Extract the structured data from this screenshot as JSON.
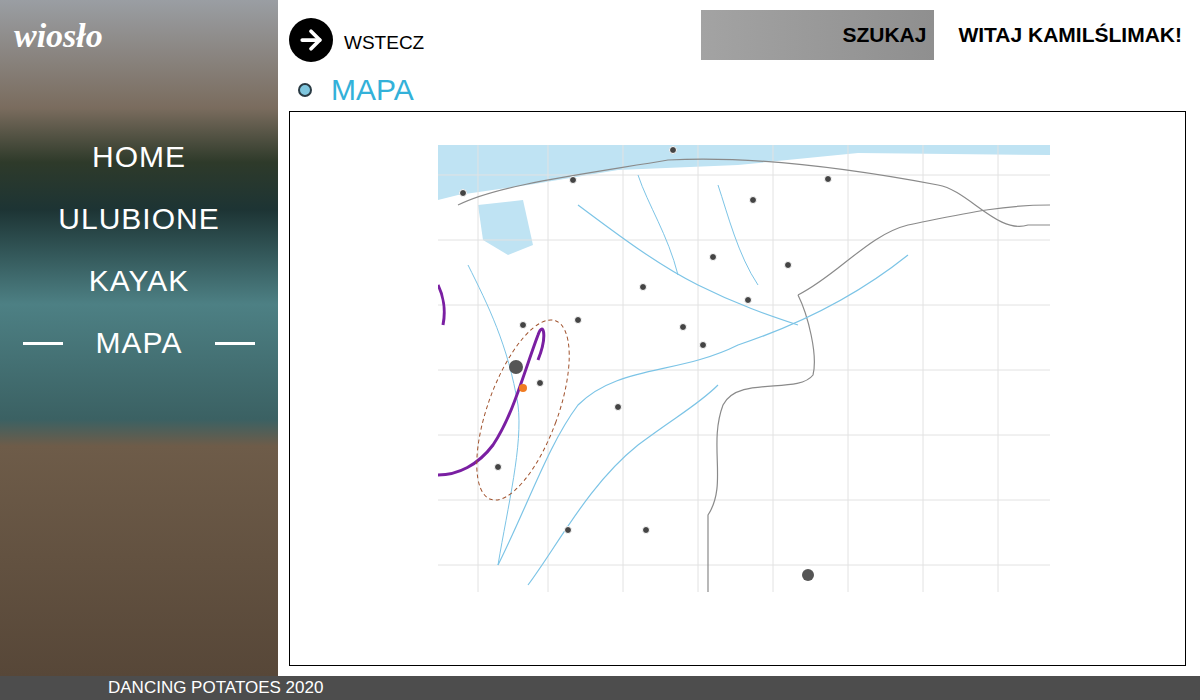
{
  "logo": "wiosło",
  "nav": [
    {
      "label": "HOME",
      "selected": false
    },
    {
      "label": "ULUBIONE",
      "selected": false
    },
    {
      "label": "KAYAK",
      "selected": false
    },
    {
      "label": "MAPA",
      "selected": true
    }
  ],
  "back": {
    "label": "WSTECZ"
  },
  "search": {
    "label": "SZUKAJ"
  },
  "greeting": "WITAJ KAMILŚLIMAK!",
  "page": {
    "title": "MAPA"
  },
  "footer": "DANCING POTATOES 2020"
}
